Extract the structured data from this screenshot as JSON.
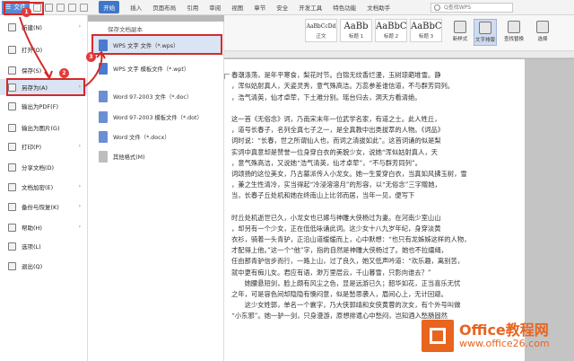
{
  "topbar": {
    "file_label": "文件",
    "tabs": [
      "开始",
      "插入",
      "页面布局",
      "引用",
      "审阅",
      "视图",
      "章节",
      "安全",
      "开发工具",
      "特色功能",
      "文档助手"
    ],
    "search_placeholder": "Q查找WPS"
  },
  "ribbon": {
    "styles": [
      {
        "sample": "AaBbCcDd",
        "caption": "正文"
      },
      {
        "sample": "AaBb",
        "caption": "标题 1"
      },
      {
        "sample": "AaBbC",
        "caption": "标题 2"
      },
      {
        "sample": "AaBbC",
        "caption": "标题 3"
      }
    ],
    "buttons": [
      "新样式",
      "文字排版",
      "查找替换",
      "选择"
    ]
  },
  "file_menu": {
    "items": [
      {
        "label": "新建(N)",
        "arrow": "›"
      },
      {
        "label": "打开(O)",
        "arrow": ""
      },
      {
        "label": "保存(S)",
        "arrow": ""
      },
      {
        "label": "另存为(A)",
        "arrow": "›"
      },
      {
        "label": "输出为PDF(F)",
        "arrow": ""
      },
      {
        "label": "输出为图片(G)",
        "arrow": ""
      },
      {
        "label": "打印(P)",
        "arrow": "›"
      },
      {
        "label": "分享文档(D)",
        "arrow": ""
      },
      {
        "label": "文档加密(E)",
        "arrow": "›"
      },
      {
        "label": "备份与恢复(K)",
        "arrow": "›"
      },
      {
        "label": "帮助(H)",
        "arrow": "›"
      },
      {
        "label": "选项(L)",
        "arrow": ""
      },
      {
        "label": "退出(Q)",
        "arrow": ""
      }
    ]
  },
  "save_as": {
    "title": "保存文档副本",
    "items": [
      {
        "label": "WPS 文字 文件（*.wps）",
        "color": "#4a7bd0"
      },
      {
        "label": "WPS 文字 模板文件（*.wpt）",
        "color": "#4a7bd0"
      },
      {
        "label": "Word 97-2003 文件（*.doc）",
        "color": "#6b8fd3"
      },
      {
        "label": "Word 97-2003 模板文件（*.dot）",
        "color": "#6b8fd3"
      },
      {
        "label": "Word 文件（*.docx）",
        "color": "#6b8fd3"
      },
      {
        "label": "其他格式(M)",
        "color": "#9a9a9a"
      }
    ]
  },
  "badges": [
    "1",
    "2",
    "3"
  ],
  "document": {
    "lines": [
      "",
      "春潮涤荡，是年平寒食，梨花时节。白锦无纹香烂漫，玉树琼葩堆雪。静",
      "，浑似姑射真人，天姿灵秀，意气殊高洁。万蕊参差谁信道，不与群芳同列。",
      "，浩气清英，仙才卓荦，下土难分别。瑶台归去，洞天方看清绝。",
      "",
      "这一首《无俗念》词，乃南宋末年一位武学名家，有道之士。此人姓丘，",
      "，道号长春子，名列全真七子之一，是全真教中出类拔萃的人物。《词品》",
      "词时说：“长春，世之所谓仙人也，而词之清拔如此”。这首词诵的似是梨",
      "实词中真意却是赞誉一位身穿白衣的美貌少女，说她“浑似姑射真人，天",
      "，意气殊高洁，又说她“浩气清英，仙才卓荦”，“不与群芳同列”。",
      "词颂扬的这位美女，乃古墓派传人小龙女。她一生爱穿白衣，当真如风拂玉树，雪",
      "，兼之生性清冷，实当得起“冷浸溶溶月”的形容，以“无俗念”三字赠她，",
      "当，长春子丘处机和她在终南山上比邻而居，当年一见，便写下",
      "",
      "时丘处机逝世已久，小龙女也已嫁与神雕大侠杨过为妻。在河南少室山山",
      "，却另有一个少女，正在低低咏诵此词。这少女十八九岁年纪，身穿淡黄",
      "衣衫，骑着一头青驴，正沿山道缓缓而上，心中默想：“也只有龙姊姊这样的人物，",
      "才配得上他。”这一个“他”字，指的自然是神雕大侠杨过了。她也不拉缰绳，",
      "任由那青驴信步而行，一路上山，过了良久，她又低声吟道：“欢乐趣，离别苦，",
      "就中更有痴儿女。君应有语，渺万里层云，千山暮雪，只影向谁去？”",
      "　　她腰悬短剑，脸上颇有风尘之色，显是远游已久；韶华如花，正当喜乐无忧",
      "之年，可是容色间却隐隐有懊闷意，似是愁思袭人，眉间心上，无计回避。",
      "　　这少女姓郭，单名一个襄字，乃大侠郭靖和女侠黄蓉的次女，有个外号叫做",
      "“小东邪”。她一驴一剑，只身漫游，原想排遣心中愁闷，岂知酒入愁肠固然"
    ]
  },
  "watermark": {
    "brand": "Office教程网",
    "url": "www.office26.com"
  }
}
